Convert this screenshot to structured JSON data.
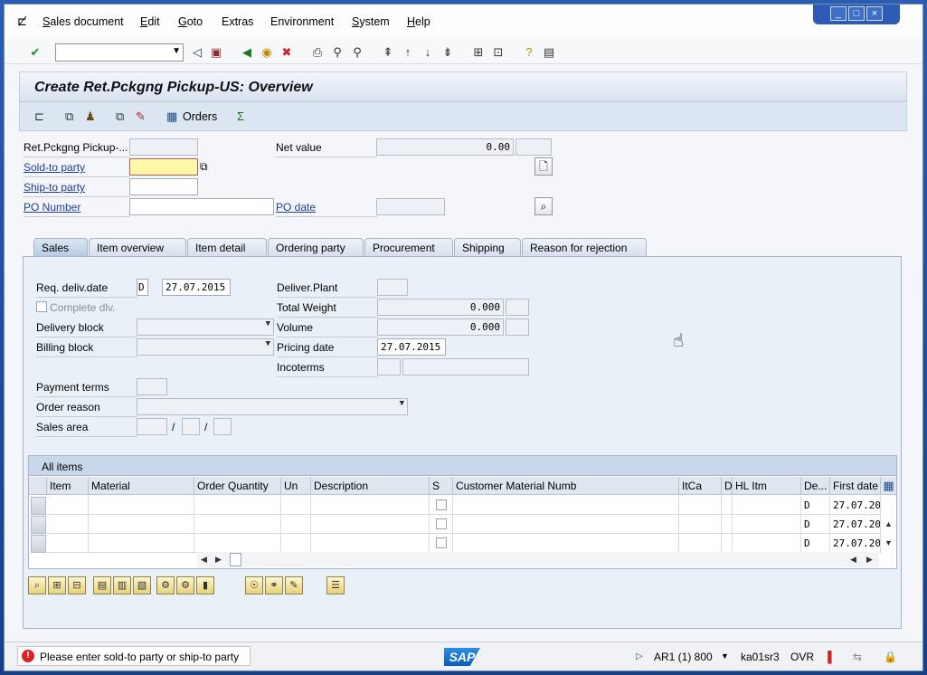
{
  "menu": {
    "items": [
      {
        "pre": "S",
        "rest": "ales document"
      },
      {
        "pre": "E",
        "rest": "dit"
      },
      {
        "pre": "G",
        "rest": "oto"
      },
      {
        "pre": "",
        "rest": "Extras"
      },
      {
        "pre": "",
        "rest": "Environment"
      },
      {
        "pre": "S",
        "rest": "ystem"
      },
      {
        "pre": "H",
        "rest": "elp"
      }
    ]
  },
  "window_controls": [
    "_",
    "□",
    "×"
  ],
  "title": "Create Ret.Pckgng Pickup-US: Overview",
  "app_toolbar": {
    "orders_label": "Orders"
  },
  "header": {
    "doc_label": "Ret.Pckgng Pickup-...",
    "sold_to_label": "Sold-to party",
    "ship_to_label": "Ship-to party",
    "po_number_label": "PO Number",
    "net_value_label": "Net value",
    "net_value": "0.00",
    "po_date_label": "PO date"
  },
  "tabs": [
    "Sales",
    "Item overview",
    "Item detail",
    "Ordering party",
    "Procurement",
    "Shipping",
    "Reason for rejection"
  ],
  "sales": {
    "req_deliv_date_label": "Req. deliv.date",
    "req_deliv_type": "D",
    "req_deliv_date": "27.07.2015",
    "complete_dlv_label": "Complete dlv.",
    "delivery_block_label": "Delivery block",
    "billing_block_label": "Billing block",
    "deliver_plant_label": "Deliver.Plant",
    "total_weight_label": "Total Weight",
    "total_weight": "0.000",
    "volume_label": "Volume",
    "volume": "0.000",
    "pricing_date_label": "Pricing date",
    "pricing_date": "27.07.2015",
    "incoterms_label": "Incoterms",
    "payment_terms_label": "Payment terms",
    "order_reason_label": "Order reason",
    "sales_area_label": "Sales area",
    "sep1": "/",
    "sep2": "/"
  },
  "items_table": {
    "caption": "All items",
    "columns": [
      "Item",
      "Material",
      "Order Quantity",
      "Un",
      "Description",
      "S",
      "Customer Material Numb",
      "ItCa",
      "D",
      "HL Itm",
      "De...",
      "First date"
    ],
    "rows": [
      {
        "de": "D",
        "first_date": "27.07.2015"
      },
      {
        "de": "D",
        "first_date": "27.07.2015"
      },
      {
        "de": "D",
        "first_date": "27.07.2015"
      }
    ]
  },
  "status": {
    "message": "Please enter sold-to party or ship-to party",
    "system": "AR1 (1) 800",
    "server": "ka01sr3",
    "mode": "OVR"
  },
  "logo": "SAP"
}
